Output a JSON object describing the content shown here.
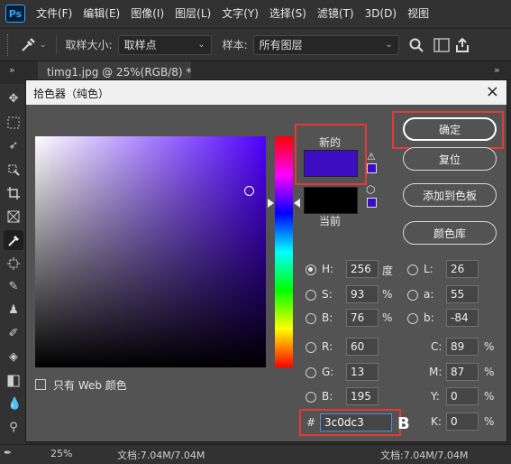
{
  "menubar": {
    "app_logo": "Ps",
    "items": [
      "文件(F)",
      "编辑(E)",
      "图像(I)",
      "图层(L)",
      "文字(Y)",
      "选择(S)",
      "滤镜(T)",
      "3D(D)",
      "视图"
    ]
  },
  "options": {
    "sample_size_label": "取样大小:",
    "sample_size_value": "取样点",
    "sample_label": "样本:",
    "sample_value": "所有图层"
  },
  "tabs": {
    "collapse": "»",
    "doc_tab": "timg1.jpg @ 25%(RGB/8) *",
    "close": "×"
  },
  "status": {
    "zoom": "25%",
    "doc_info_left": "文档:7.04M/7.04M",
    "doc_info_right": "文档:7.04M/7.04M"
  },
  "dialog": {
    "title": "拾色器（纯色）",
    "close": "×",
    "new_label": "新的",
    "current_label": "当前",
    "new_color": "#3c0dc3",
    "current_color": "#000000",
    "buttons": {
      "ok": "确定",
      "reset": "复位",
      "add_to_swatches": "添加到色板",
      "color_libraries": "颜色库"
    },
    "web_only_label": "只有 Web 颜色",
    "hsb": {
      "h_label": "H:",
      "h_value": "256",
      "h_unit": "度",
      "s_label": "S:",
      "s_value": "93",
      "s_unit": "%",
      "b_label": "B:",
      "b_value": "76",
      "b_unit": "%"
    },
    "lab": {
      "l_label": "L:",
      "l_value": "26",
      "a_label": "a:",
      "a_value": "55",
      "b_label": "b:",
      "b_value": "-84"
    },
    "rgb": {
      "r_label": "R:",
      "r_value": "60",
      "g_label": "G:",
      "g_value": "13",
      "b_label": "B:",
      "b_value": "195"
    },
    "cmyk": {
      "c_label": "C:",
      "c_value": "89",
      "m_label": "M:",
      "m_value": "87",
      "y_label": "Y:",
      "y_value": "0",
      "k_label": "K:",
      "k_value": "0",
      "unit": "%"
    },
    "hex_label": "#",
    "hex_value": "3c0dc3",
    "base_hue": "#5000ff",
    "hue_fraction": 0.289,
    "saturation": 0.93,
    "brightness": 0.76
  },
  "colors": {
    "highlight": "#e53935",
    "panel": "#535353"
  }
}
